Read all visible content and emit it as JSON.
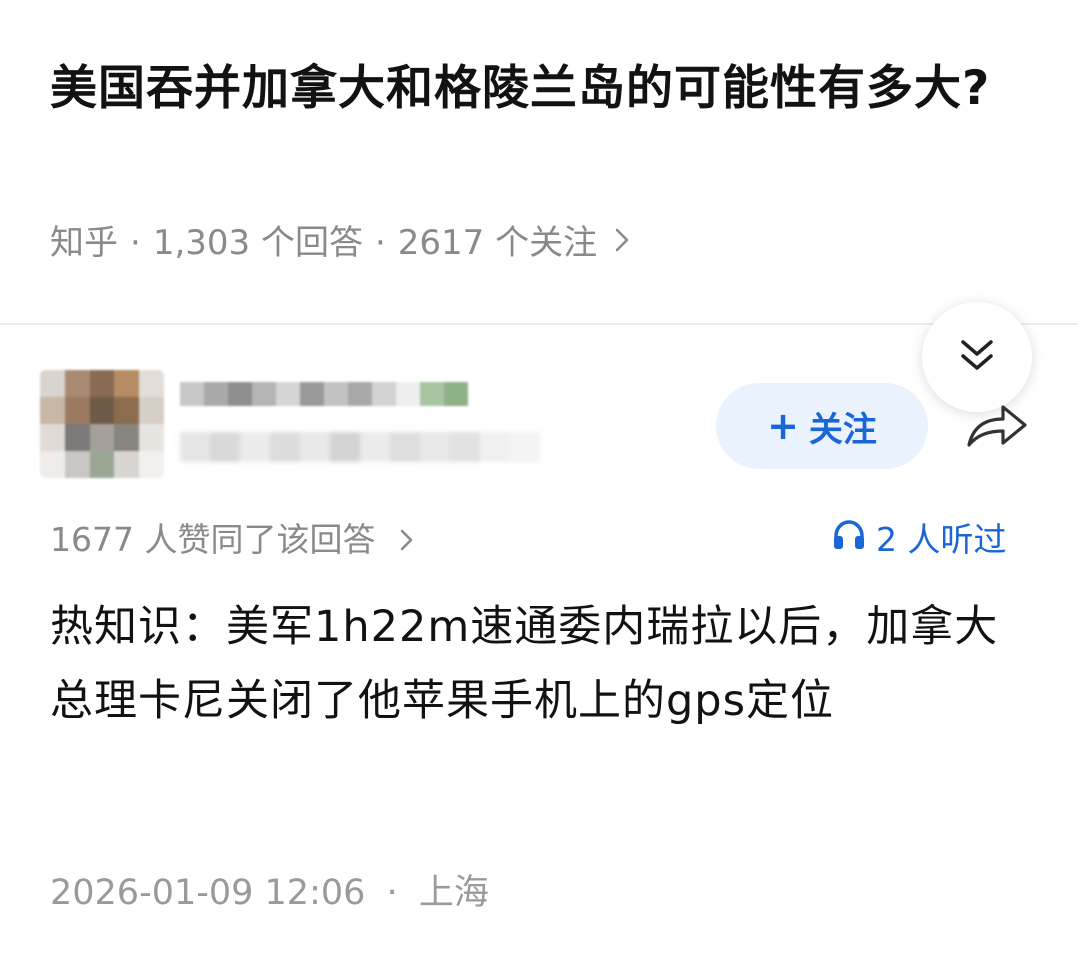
{
  "question": {
    "title": "美国吞并加拿大和格陵兰岛的可能性有多大?",
    "source": "知乎",
    "answer_count": "1,303 个回答",
    "follower_count": "2617 个关注"
  },
  "author": {
    "follow_label": "关注"
  },
  "answer": {
    "likes_text": "1677 人赞同了该回答",
    "listened_text": "2 人听过",
    "body": "热知识：美军1h22m速通委内瑞拉以后，加拿大总理卡尼关闭了他苹果手机上的gps定位",
    "timestamp": "2026-01-09 12:06",
    "location": "上海"
  },
  "colors": {
    "accent": "#1a66d6",
    "follow_bg": "#eaf2fd",
    "muted_text": "#8a8a8a"
  },
  "icons": [
    "chevron-right-icon",
    "double-chevron-down-icon",
    "plus-icon",
    "share-icon",
    "headphones-icon"
  ]
}
